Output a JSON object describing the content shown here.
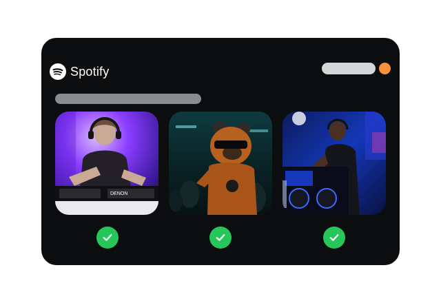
{
  "app": {
    "brand_name": "Spotify",
    "brand_icon": "spotify-logo-icon",
    "status_dot_color": "#f6923a",
    "accent_check_color": "#27c65a"
  },
  "tiles": [
    {
      "icon": "dj-purple-stage-image",
      "selected": true
    },
    {
      "icon": "bear-mascot-club-image",
      "selected": true
    },
    {
      "icon": "dj-blue-booth-image",
      "selected": true
    }
  ]
}
